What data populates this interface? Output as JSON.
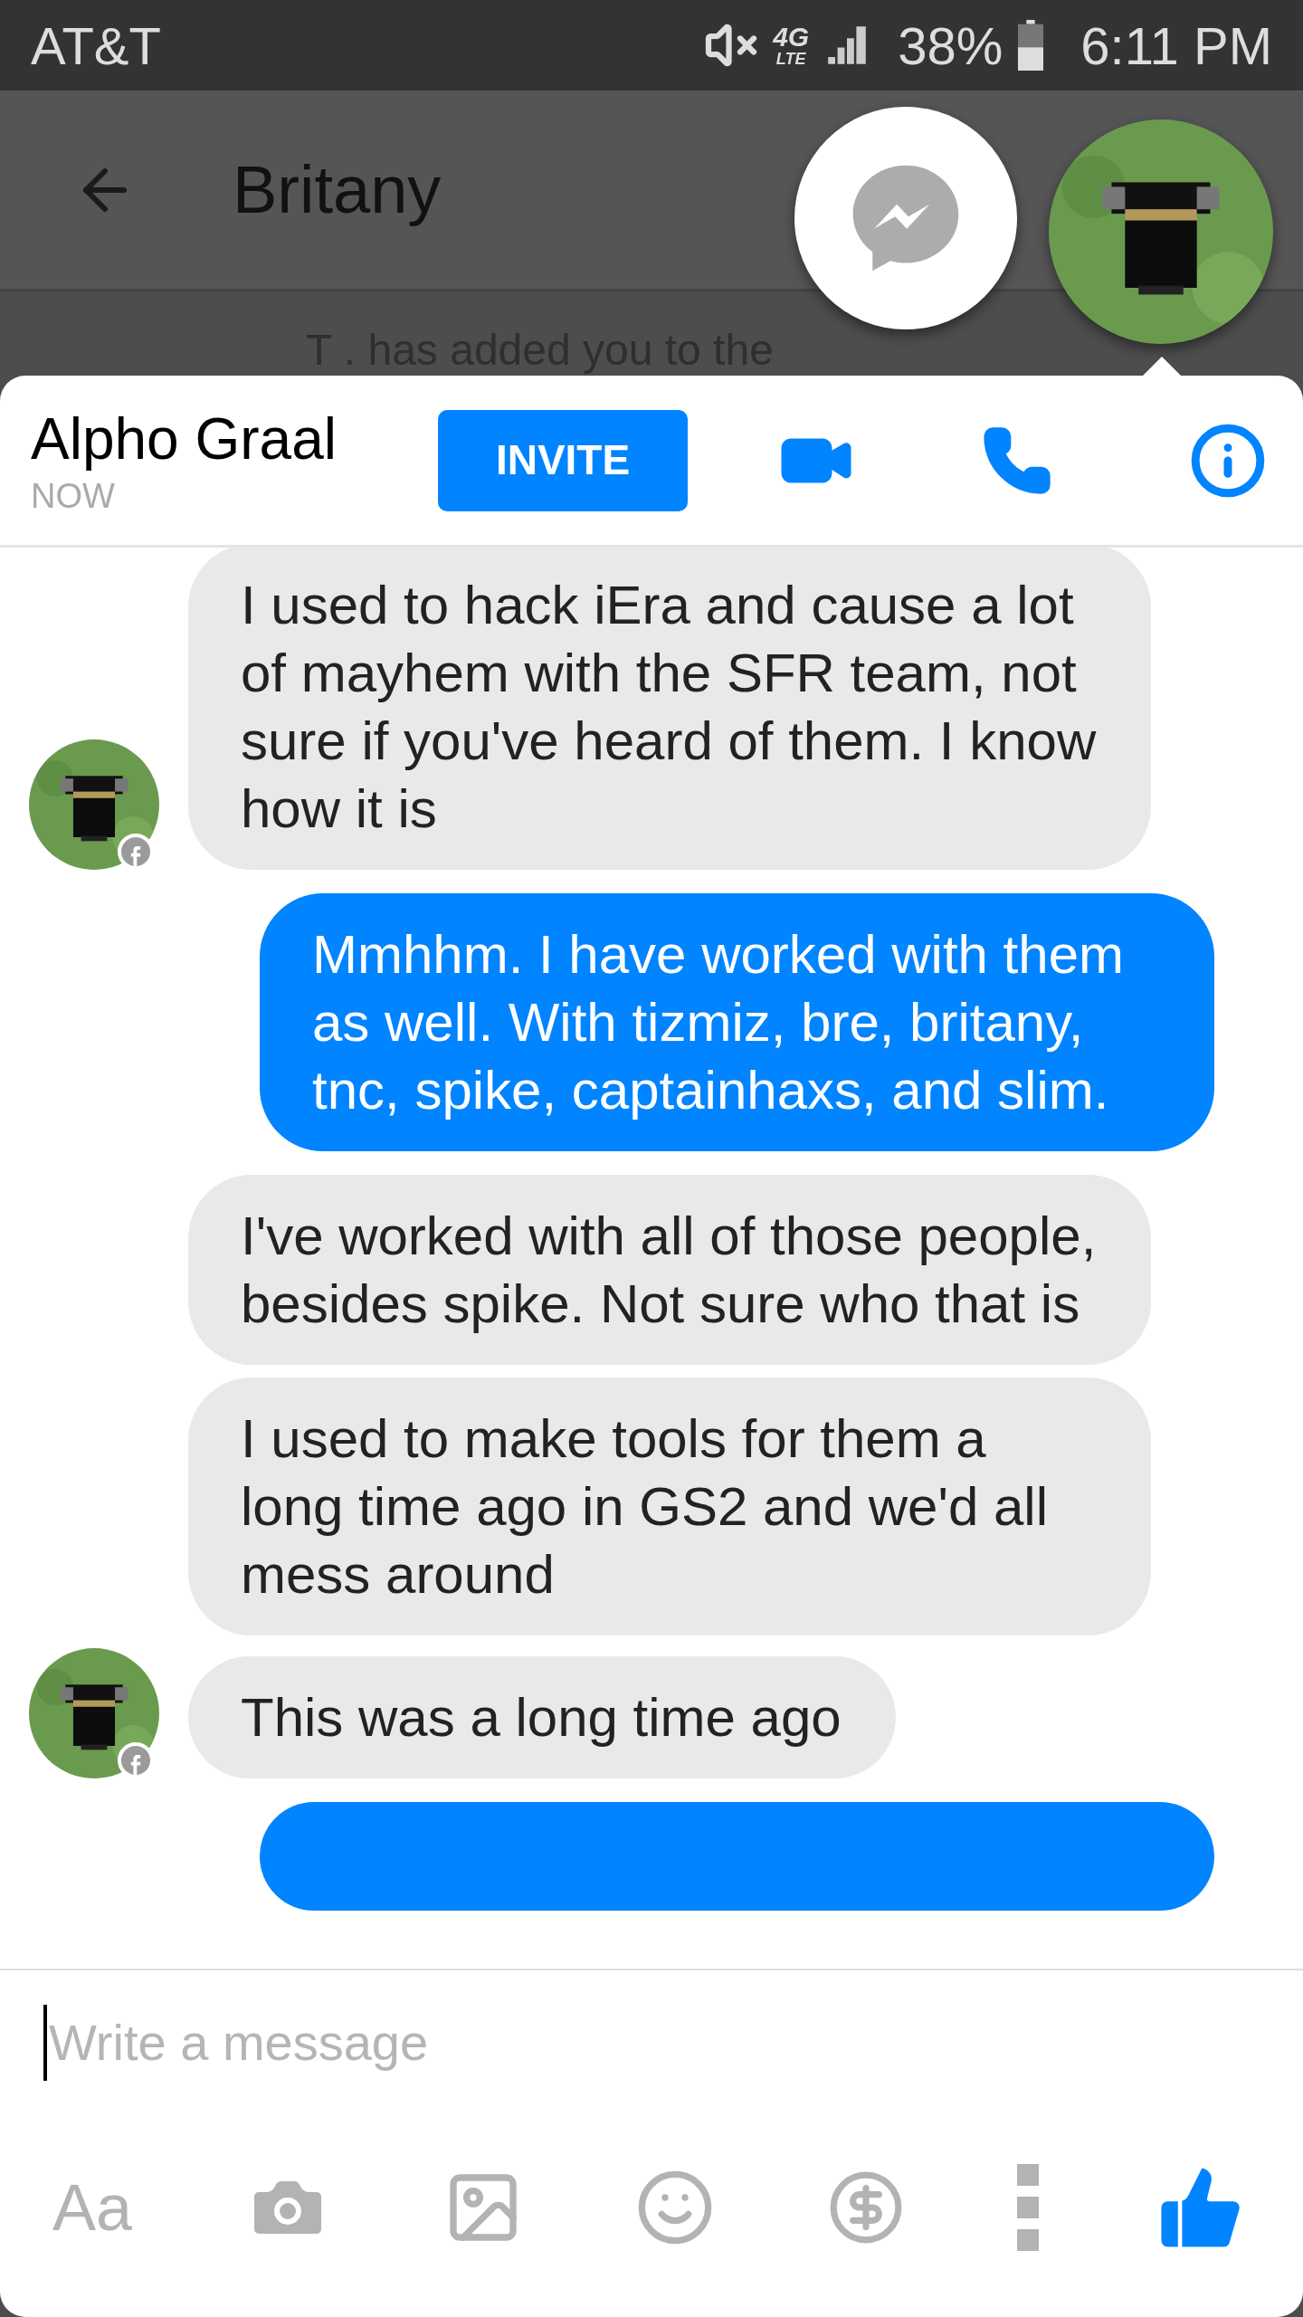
{
  "status_bar": {
    "carrier": "AT&T",
    "network": "4G",
    "network_type": "LTE",
    "battery": "38%",
    "time": "6:11 PM"
  },
  "header": {
    "title": "Britany",
    "note": "T . has added you to the"
  },
  "chat_head": {
    "name": "Alpho Graal",
    "status": "NOW",
    "invite": "INVITE"
  },
  "messages": [
    {
      "kind": "incoming",
      "avatar": true,
      "text": "I used to hack iEra and cause a lot of mayhem with the SFR team, not sure if you've heard of them. I know how it is"
    },
    {
      "kind": "outgoing",
      "text": "Mmhhm. I have worked with them as well. With tizmiz, bre, britany, tnc, spike, captainhaxs, and slim."
    },
    {
      "kind": "incoming",
      "avatar": false,
      "text": "I've worked with all of those people, besides spike. Not sure who that is"
    },
    {
      "kind": "incoming",
      "avatar": false,
      "text": "I used to make tools for them a long time ago in GS2 and we'd all mess around"
    },
    {
      "kind": "incoming",
      "avatar": true,
      "text": "This was a long time ago"
    },
    {
      "kind": "outgoing"
    }
  ],
  "composer": {
    "placeholder": "Write a message",
    "text_format": "Aa"
  }
}
